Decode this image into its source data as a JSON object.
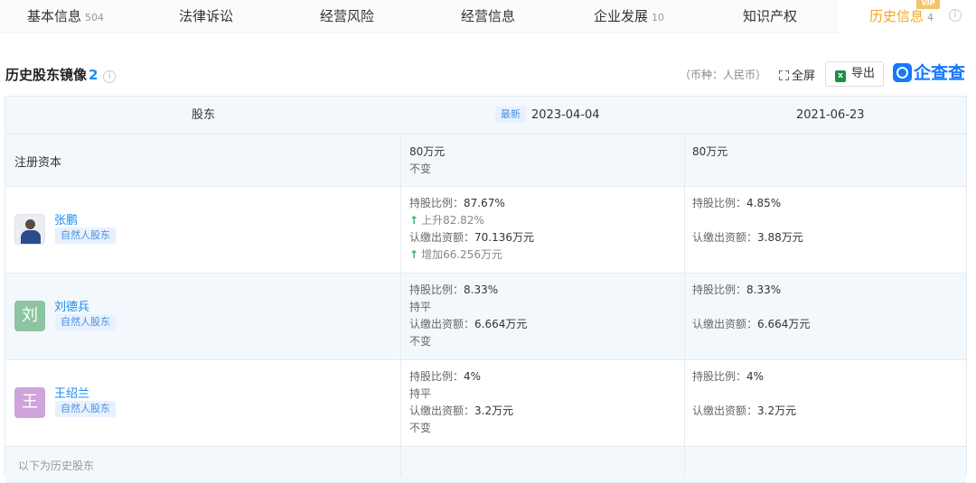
{
  "tabs": [
    {
      "label": "基本信息",
      "count": "504"
    },
    {
      "label": "法律诉讼",
      "count": ""
    },
    {
      "label": "经营风险",
      "count": ""
    },
    {
      "label": "经营信息",
      "count": ""
    },
    {
      "label": "企业发展",
      "count": "10"
    },
    {
      "label": "知识产权",
      "count": ""
    },
    {
      "label": "历史信息",
      "count": "4",
      "badge": "VIP"
    }
  ],
  "section": {
    "title": "历史股东镜像",
    "count": "2",
    "currency": "（币种：人民币）",
    "fullscreen": "全屏",
    "export": "导出",
    "logo": "企查查"
  },
  "table": {
    "headers": {
      "col0": "股东",
      "latest_tag": "最新",
      "col1": "2023-04-04",
      "col2": "2021-06-23"
    },
    "capital": {
      "label": "注册资本",
      "col1_value": "80万元",
      "col1_change": "不变",
      "col2_value": "80万元"
    },
    "rows": [
      {
        "name": "张鹏",
        "tag": "自然人股东",
        "avatar_char": "",
        "col1": {
          "ratio_label": "持股比例：",
          "ratio": "87.67%",
          "ratio_change": "上升82.82%",
          "amount_label": "认缴出资额：",
          "amount": "70.136万元",
          "amount_change": "增加66.256万元"
        },
        "col2": {
          "ratio_label": "持股比例：",
          "ratio": "4.85%",
          "amount_label": "认缴出资额：",
          "amount": "3.88万元"
        }
      },
      {
        "name": "刘德兵",
        "tag": "自然人股东",
        "avatar_char": "刘",
        "col1": {
          "ratio_label": "持股比例：",
          "ratio": "8.33%",
          "ratio_change": "持平",
          "amount_label": "认缴出资额：",
          "amount": "6.664万元",
          "amount_change": "不变"
        },
        "col2": {
          "ratio_label": "持股比例：",
          "ratio": "8.33%",
          "amount_label": "认缴出资额：",
          "amount": "6.664万元"
        }
      },
      {
        "name": "王绍兰",
        "tag": "自然人股东",
        "avatar_char": "王",
        "col1": {
          "ratio_label": "持股比例：",
          "ratio": "4%",
          "ratio_change": "持平",
          "amount_label": "认缴出资额：",
          "amount": "3.2万元",
          "amount_change": "不变"
        },
        "col2": {
          "ratio_label": "持股比例：",
          "ratio": "4%",
          "amount_label": "认缴出资额：",
          "amount": "3.2万元"
        }
      }
    ],
    "footer": "以下为历史股东"
  },
  "colors": {
    "accent": "#1a8cf0",
    "active_tab": "#f5a623",
    "up_arrow": "#2db36f",
    "avatar_liu": "#8dc4a1",
    "avatar_wang": "#cfa3dc"
  }
}
